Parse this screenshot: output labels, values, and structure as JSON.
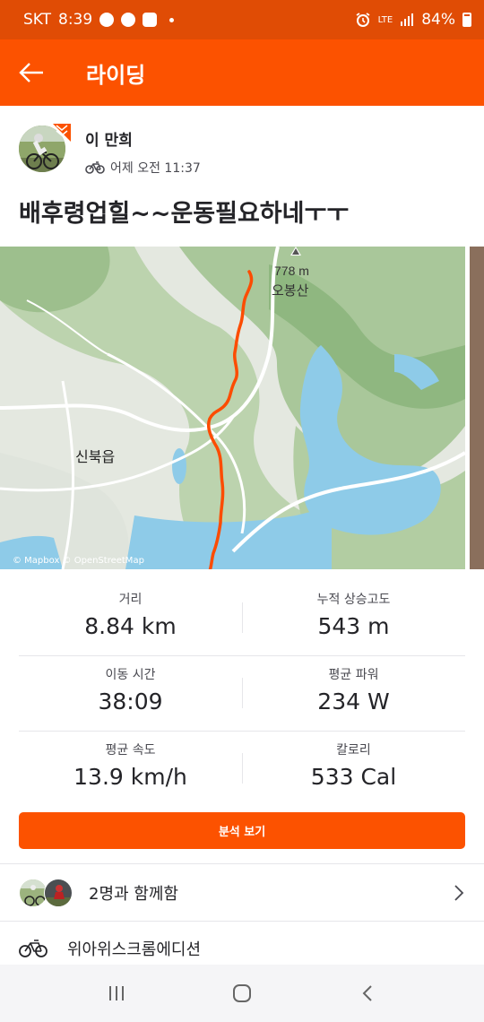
{
  "status_bar": {
    "carrier": "SKT",
    "time": "8:39",
    "network": "LTE",
    "battery": "84%",
    "notification_icons": [
      "chat-icon",
      "talk-icon",
      "gallery-icon"
    ],
    "right_icons": [
      "alarm-icon",
      "signal-icon",
      "battery-icon"
    ]
  },
  "app_bar": {
    "title": "라이딩",
    "back_icon": "arrow-left-icon"
  },
  "author": {
    "name": "이 만희",
    "meta": "어제 오전 11:37",
    "activity_icon": "bicycle-icon"
  },
  "activity": {
    "title": "배후령업힐~~운동필요하네ㅜㅜ"
  },
  "map": {
    "peak_elevation": "778 m",
    "peak_name": "오봉산",
    "town_name": "신북읍",
    "attribution": "© Mapbox © OpenStreetMap",
    "route_color": "#fc4c02"
  },
  "stats": [
    {
      "label": "거리",
      "value": "8.84 km"
    },
    {
      "label": "누적 상승고도",
      "value": "543 m"
    },
    {
      "label": "이동 시간",
      "value": "38:09"
    },
    {
      "label": "평균 파워",
      "value": "234 W"
    },
    {
      "label": "평균 속도",
      "value": "13.9 km/h"
    },
    {
      "label": "칼로리",
      "value": "533 Cal"
    }
  ],
  "analysis_button": {
    "label": "분석 보기"
  },
  "group": {
    "text": "2명과 함께함"
  },
  "gear": {
    "name": "위아위스크롬에디션"
  },
  "colors": {
    "brand": "#fc5200",
    "status_bar": "#e04c05",
    "text": "#242428"
  }
}
